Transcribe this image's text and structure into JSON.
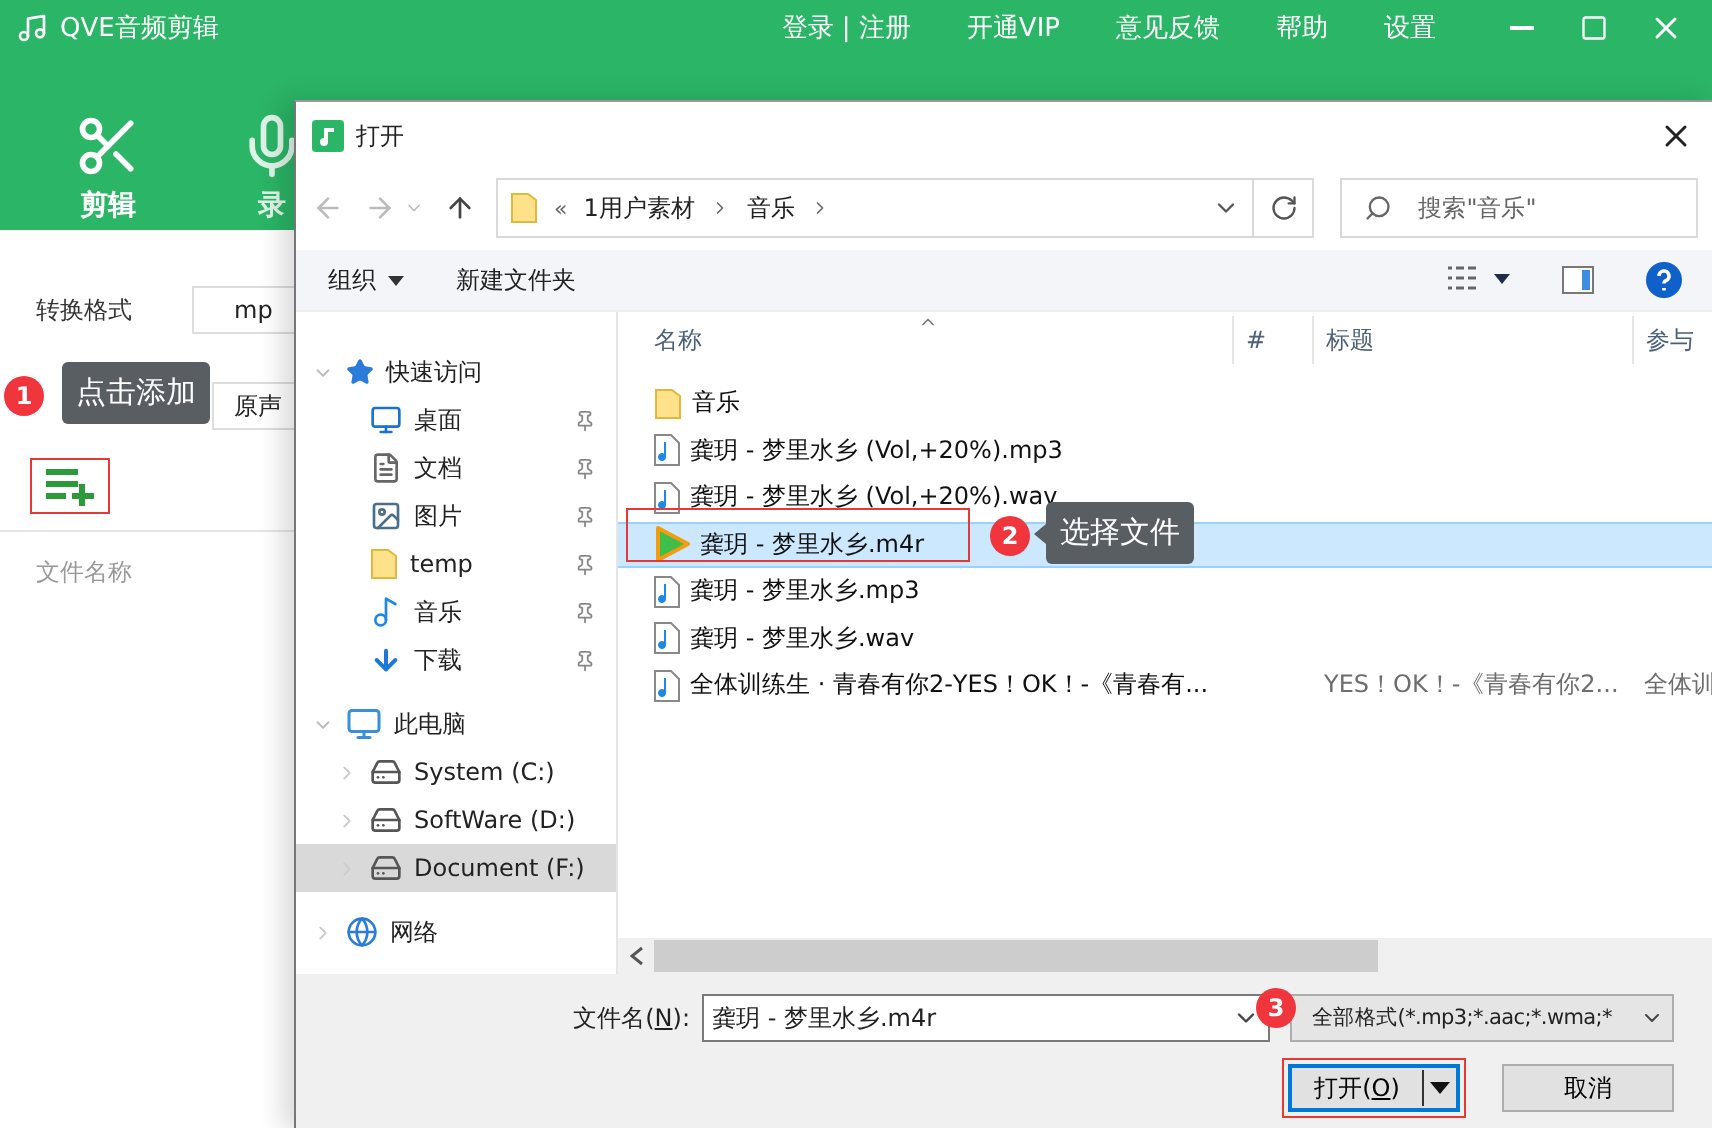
{
  "app": {
    "title": "QVE音频剪辑",
    "menu": [
      "登录 | 注册",
      "开通VIP",
      "意见反馈",
      "帮助",
      "设置"
    ],
    "tabs": [
      {
        "label": "剪辑",
        "kind": "scissors",
        "selected": true
      },
      {
        "label": "录",
        "kind": "mic",
        "selected": false
      }
    ],
    "format": {
      "label": "转换格式",
      "value": "mp"
    },
    "channel": {
      "value": "原声"
    },
    "list_header": "文件名称"
  },
  "steps": [
    {
      "number": "1",
      "tip": "点击添加"
    },
    {
      "number": "2",
      "tip": "选择文件"
    },
    {
      "number": "3"
    }
  ],
  "dialog": {
    "title": "打开",
    "path_overflow": "«",
    "path": [
      "1用户素材",
      "音乐"
    ],
    "search": {
      "placeholder": "搜索\"音乐\""
    },
    "toolbar": [
      "组织",
      "新建文件夹"
    ],
    "nav": [
      {
        "label": "快速访问",
        "kind": "star",
        "expanded": true,
        "selected": false,
        "children": [
          {
            "label": "桌面",
            "kind": "desktop",
            "pinned": true,
            "selected": false
          },
          {
            "label": "文档",
            "kind": "document",
            "pinned": true,
            "selected": false
          },
          {
            "label": "图片",
            "kind": "pictures",
            "pinned": true,
            "selected": false
          },
          {
            "label": "temp",
            "kind": "folder",
            "pinned": true,
            "selected": false
          },
          {
            "label": "音乐",
            "kind": "music",
            "pinned": true,
            "selected": false
          },
          {
            "label": "下载",
            "kind": "download",
            "pinned": true,
            "selected": false
          }
        ]
      },
      {
        "label": "此电脑",
        "kind": "computer",
        "expanded": true,
        "selected": false,
        "children": [
          {
            "label": "System (C:)",
            "kind": "system-drive",
            "expanded": false,
            "selected": false
          },
          {
            "label": "SoftWare (D:)",
            "kind": "drive",
            "expanded": false,
            "selected": false
          },
          {
            "label": "Document (F:)",
            "kind": "drive",
            "expanded": false,
            "selected": true
          }
        ]
      },
      {
        "label": "网络",
        "kind": "network",
        "expanded": false,
        "selected": false
      }
    ],
    "columns": [
      "名称",
      "#",
      "标题",
      "参与"
    ],
    "files": [
      {
        "name": "音乐",
        "kind": "folder",
        "selected": false
      },
      {
        "name": "龚玥 - 梦里水乡 (Vol,+20%).mp3",
        "kind": "audio",
        "selected": false
      },
      {
        "name": "龚玥 - 梦里水乡 (Vol,+20%).wav",
        "kind": "audio",
        "selected": false
      },
      {
        "name": "龚玥 - 梦里水乡.m4r",
        "kind": "video",
        "selected": true
      },
      {
        "name": "龚玥 - 梦里水乡.mp3",
        "kind": "audio",
        "selected": false
      },
      {
        "name": "龚玥 - 梦里水乡.wav",
        "kind": "audio",
        "selected": false
      },
      {
        "name": "全体训练生 · 青春有你2-YES！OK！-《青春有...",
        "title": "YES！OK！-《青春有你2...",
        "column_4": "全体训",
        "kind": "audio",
        "selected": false
      }
    ],
    "filename": {
      "label_parts": [
        "文件名(",
        "N",
        "):"
      ],
      "value": "龚玥 - 梦里水乡.m4r"
    },
    "filter": {
      "value": "全部格式(*.mp3;*.aac;*.wma;*"
    },
    "open_button": {
      "label_parts": [
        "打开(",
        "O",
        ")"
      ]
    },
    "cancel_button": "取消"
  }
}
